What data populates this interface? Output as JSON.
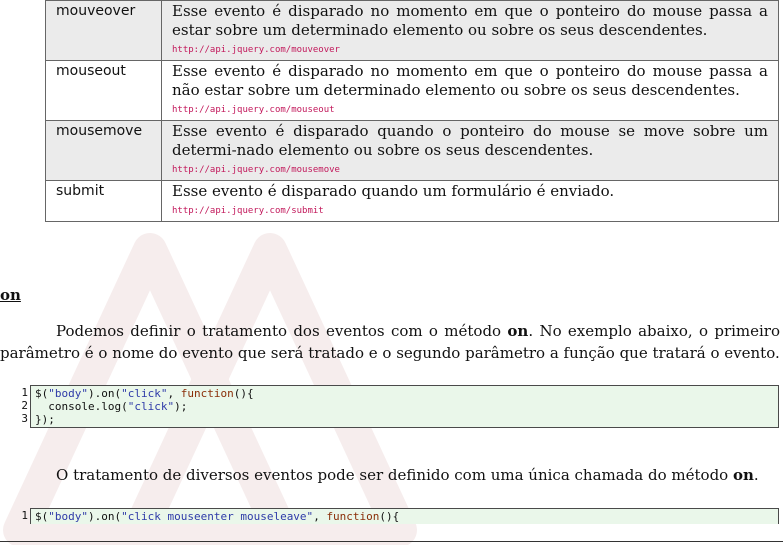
{
  "events": [
    {
      "name": "mouveover",
      "description": "Esse evento é disparado no momento em que o ponteiro do mouse passa a estar sobre um determinado elemento ou sobre os seus descendentes.",
      "url": "http://api.jquery.com/mouveover"
    },
    {
      "name": "mouseout",
      "description": "Esse evento é disparado no momento em que o ponteiro do mouse passa a não estar sobre um determinado elemento ou sobre os seus descendentes.",
      "url": "http://api.jquery.com/mouseout"
    },
    {
      "name": "mousemove",
      "description": "Esse evento é disparado quando o ponteiro do mouse se move sobre um determi-nado elemento ou sobre os seus descendentes.",
      "url": "http://api.jquery.com/mousemove"
    },
    {
      "name": "submit",
      "description": "Esse evento é disparado quando um formulário é enviado.",
      "url": "http://api.jquery.com/submit"
    }
  ],
  "section": {
    "title": "on",
    "para1_a": "Podemos definir o tratamento dos eventos com o método ",
    "para1_bold": "on",
    "para1_b": ". No exemplo abaixo, o primeiro parâmetro é o nome do evento que será tratado e o segundo parâmetro a função que tratará o evento.",
    "para2_a": "O tratamento de diversos eventos pode ser definido com uma única chamada do método ",
    "para2_bold": "on",
    "para2_b": "."
  },
  "code1": {
    "line_numbers": [
      "1",
      "2",
      "3"
    ],
    "l1_a": "$(",
    "l1_str1": "\"body\"",
    "l1_b": ").on(",
    "l1_str2": "\"click\"",
    "l1_c": ", ",
    "l1_kw": "function",
    "l1_d": "(){",
    "l2_a": "  console.log(",
    "l2_str": "\"click\"",
    "l2_b": ");",
    "l3": "});"
  },
  "code2": {
    "line_numbers": [
      "1"
    ],
    "l1_a": "$(",
    "l1_str1": "\"body\"",
    "l1_b": ").on(",
    "l1_str2": "\"click mouseenter mouseleave\"",
    "l1_c": ", ",
    "l1_kw": "function",
    "l1_d": "(){"
  }
}
